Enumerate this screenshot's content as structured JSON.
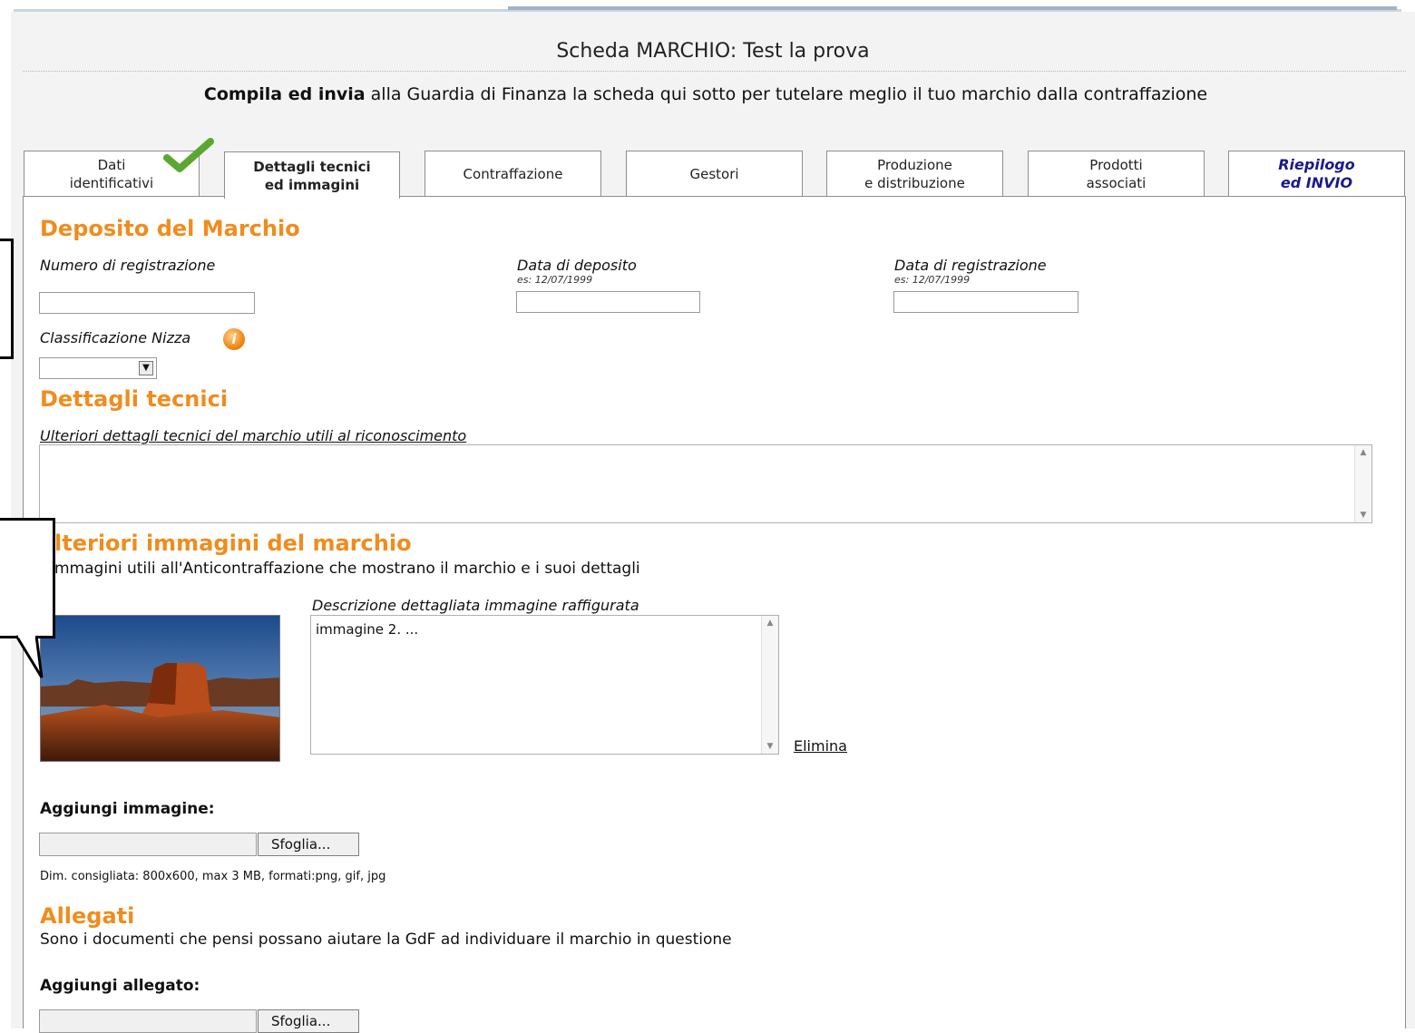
{
  "page": {
    "title": "Scheda MARCHIO: Test la prova",
    "subtitle_bold": "Compila ed invia",
    "subtitle_rest": " alla Guardia di Finanza la scheda qui sotto per tutelare meglio il tuo marchio dalla contraffazione"
  },
  "tabs": [
    {
      "line1": "Dati",
      "line2": "identificativi"
    },
    {
      "line1": "Dettagli tecnici",
      "line2": "ed immagini"
    },
    {
      "line1": "Contraffazione",
      "line2": ""
    },
    {
      "line1": "Gestori",
      "line2": ""
    },
    {
      "line1": "Produzione",
      "line2": "e distribuzione"
    },
    {
      "line1": "Prodotti",
      "line2": "associati"
    },
    {
      "line1": "Riepilogo",
      "line2": "ed INVIO"
    }
  ],
  "deposito": {
    "heading": "Deposito del Marchio",
    "numero_label": "Numero di registrazione",
    "numero_value": "",
    "data_deposito_label": "Data di deposito",
    "data_deposito_hint": "es: 12/07/1999",
    "data_deposito_value": "",
    "data_registrazione_label": "Data di registrazione",
    "data_registrazione_hint": "es: 12/07/1999",
    "data_registrazione_value": "",
    "nizza_label": "Classificazione Nizza",
    "nizza_value": ""
  },
  "dettagli": {
    "heading": "Dettagli tecnici",
    "label": "Ulteriori dettagli tecnici del marchio utili al riconoscimento",
    "value": ""
  },
  "immagini": {
    "heading": "lteriori immagini del marchio",
    "description": "mmagini utili all'Anticontraffazione che mostrano il marchio e i suoi dettagli",
    "desc_label": "Descrizione dettagliata immagine raffigurata",
    "desc_value": "immagine 2. ...",
    "delete_link": "Elimina",
    "add_label": "Aggiungi immagine:",
    "browse": "Sfoglia...",
    "hint": "Dim. consigliata: 800x600, max 3 MB, formati:png, gif, jpg"
  },
  "allegati": {
    "heading": "Allegati",
    "description": "Sono i documenti che pensi possano aiutare la GdF ad individuare il marchio in questione",
    "add_label": "Aggiungi allegato:",
    "browse": "Sfoglia..."
  },
  "colors": {
    "accent": "#f08c1e",
    "check": "#5aa832",
    "link_tab": "#1a1a8a"
  },
  "icons": {
    "check": "checkmark-icon",
    "info": "info-icon",
    "dropdown": "chevron-down-icon"
  }
}
